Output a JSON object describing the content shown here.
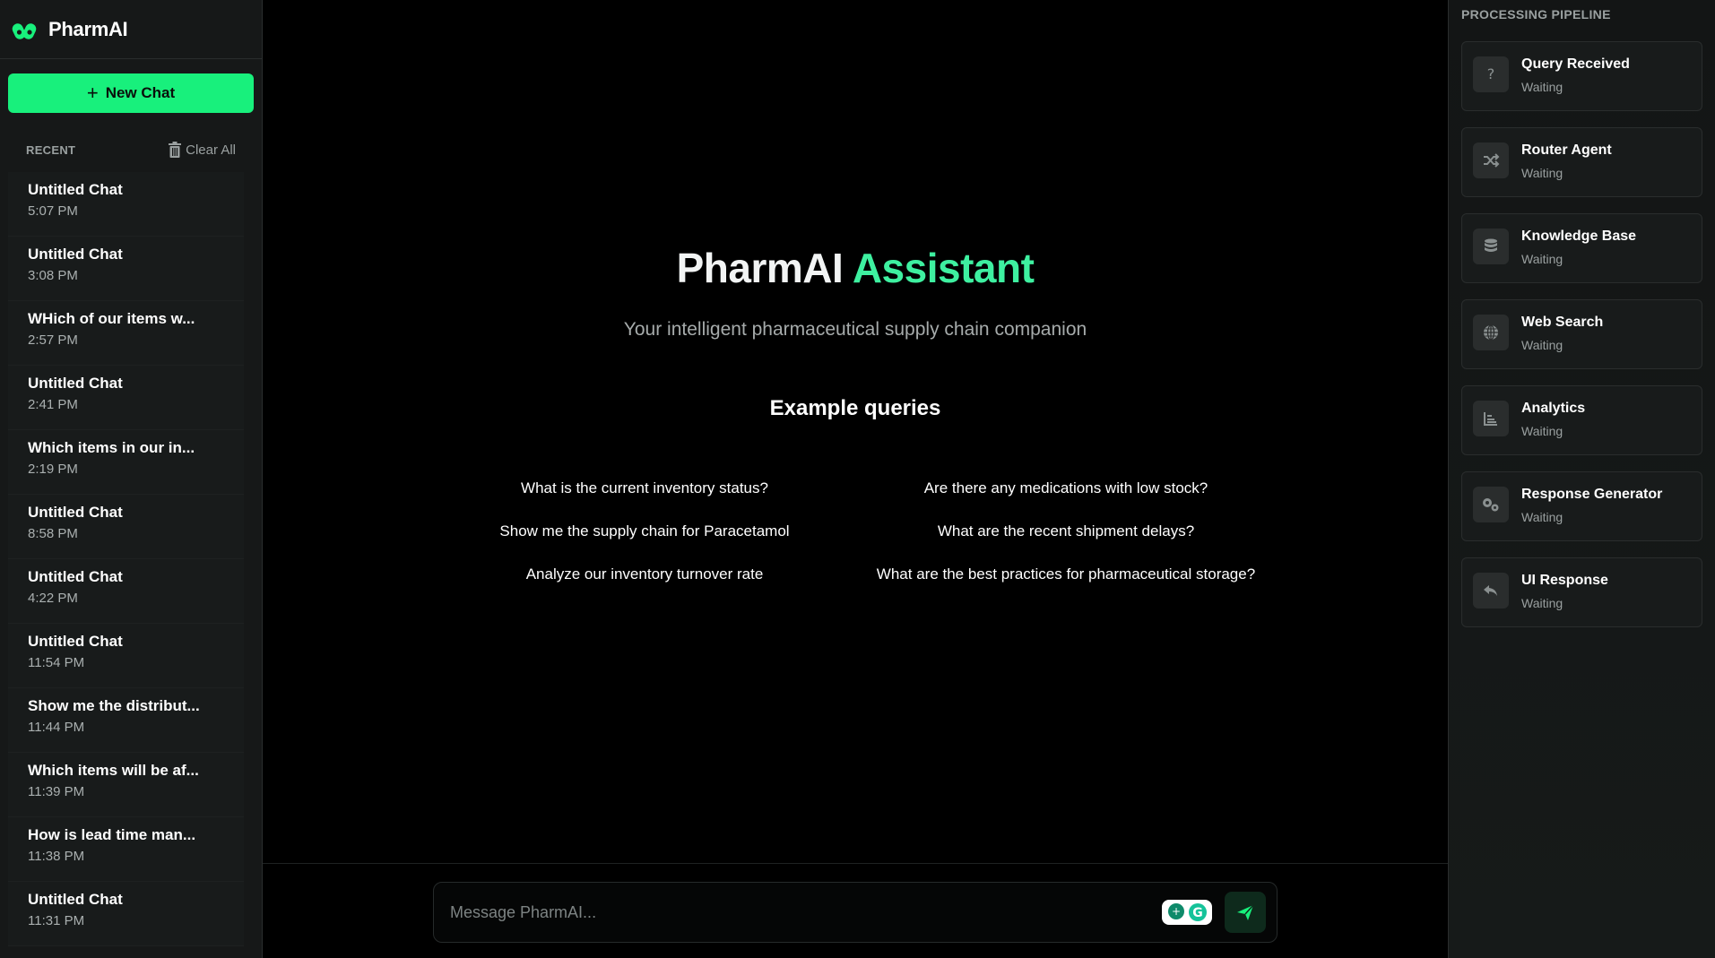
{
  "brand": {
    "name": "PharmAI"
  },
  "sidebar": {
    "new_chat_label": "New Chat",
    "recent_label": "RECENT",
    "clear_all_label": "Clear All",
    "chats": [
      {
        "title": "Untitled Chat",
        "time": "5:07 PM"
      },
      {
        "title": "Untitled Chat",
        "time": "3:08 PM"
      },
      {
        "title": "WHich of our items w...",
        "time": "2:57 PM"
      },
      {
        "title": "Untitled Chat",
        "time": "2:41 PM"
      },
      {
        "title": "Which items in our in...",
        "time": "2:19 PM"
      },
      {
        "title": "Untitled Chat",
        "time": "8:58 PM"
      },
      {
        "title": "Untitled Chat",
        "time": "4:22 PM"
      },
      {
        "title": "Untitled Chat",
        "time": "11:54 PM"
      },
      {
        "title": "Show me the distribut...",
        "time": "11:44 PM"
      },
      {
        "title": "Which items will be af...",
        "time": "11:39 PM"
      },
      {
        "title": "How is lead time man...",
        "time": "11:38 PM"
      },
      {
        "title": "Untitled Chat",
        "time": "11:31 PM"
      }
    ]
  },
  "main": {
    "title_part1": "PharmAI",
    "title_part2": "Assistant",
    "subtitle": "Your intelligent pharmaceutical supply chain companion",
    "examples_title": "Example queries",
    "examples": [
      "What is the current inventory status?",
      "Are there any medications with low stock?",
      "Show me the supply chain for Paracetamol",
      "What are the recent shipment delays?",
      "Analyze our inventory turnover rate",
      "What are the best practices for pharmaceutical storage?"
    ],
    "composer": {
      "placeholder": "Message PharmAI..."
    }
  },
  "pipeline": {
    "title": "PROCESSING PIPELINE",
    "stages": [
      {
        "name": "Query Received",
        "status": "Waiting",
        "icon": "question-icon"
      },
      {
        "name": "Router Agent",
        "status": "Waiting",
        "icon": "shuffle-icon"
      },
      {
        "name": "Knowledge Base",
        "status": "Waiting",
        "icon": "database-icon"
      },
      {
        "name": "Web Search",
        "status": "Waiting",
        "icon": "globe-icon"
      },
      {
        "name": "Analytics",
        "status": "Waiting",
        "icon": "chart-icon"
      },
      {
        "name": "Response Generator",
        "status": "Waiting",
        "icon": "gears-icon"
      },
      {
        "name": "UI Response",
        "status": "Waiting",
        "icon": "reply-icon"
      }
    ]
  },
  "colors": {
    "accent": "#18f07c",
    "title_accent": "#3ef0a0",
    "background": "#000000",
    "panel": "#161818"
  }
}
